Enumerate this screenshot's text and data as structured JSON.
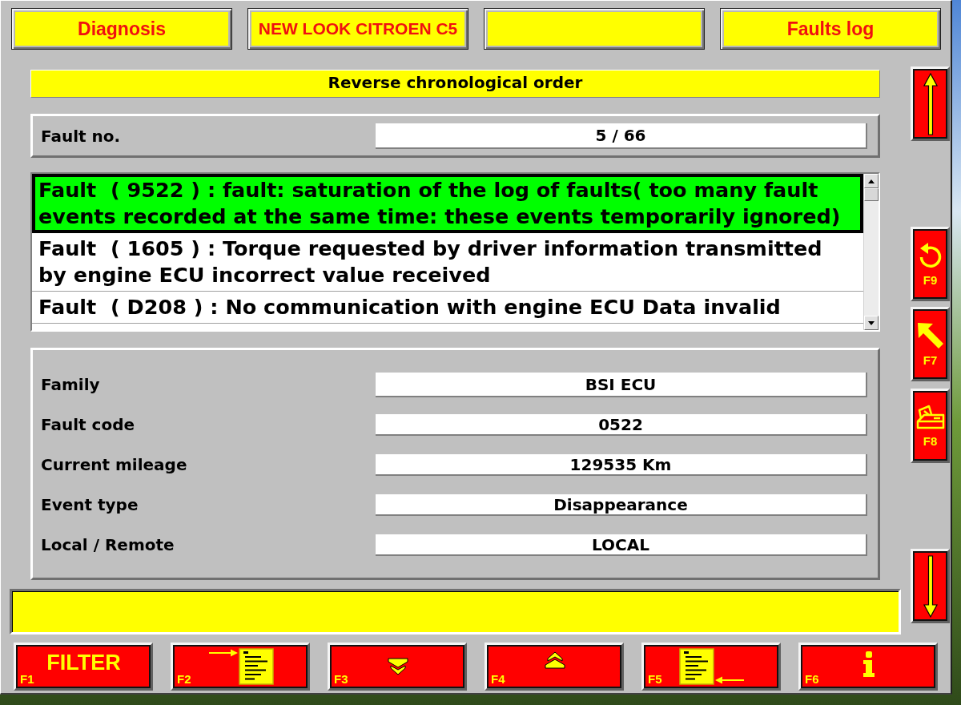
{
  "header": [
    {
      "kind": "title",
      "label": "Diagnosis"
    },
    {
      "kind": "vehicle",
      "label": "NEW LOOK CITROEN C5"
    },
    {
      "kind": "blank"
    },
    {
      "kind": "title",
      "label": "Faults log"
    }
  ],
  "sort_banner": "Reverse chronological order",
  "fault_no": {
    "label": "Fault no.",
    "value": "5 / 66"
  },
  "fault_list": [
    {
      "text": "Fault  ( 9522 ) : fault: saturation of the log of faults( too many fault events recorded at the same time: these events temporarily ignored)",
      "selected": true
    },
    {
      "text": "Fault  ( 1605 ) : Torque requested by driver information transmitted by engine ECU incorrect value received",
      "selected": false
    },
    {
      "text": "Fault  ( D208 ) : No communication with engine ECU Data invalid",
      "selected": false
    }
  ],
  "details": [
    {
      "label": "Family",
      "value": "BSI ECU"
    },
    {
      "label": "Fault code",
      "value": "0522"
    },
    {
      "label": "Current mileage",
      "value": "129535 Km"
    },
    {
      "label": "Event type",
      "value": "Disappearance"
    },
    {
      "label": "Local / Remote",
      "value": "LOCAL"
    }
  ],
  "side_buttons": [
    {
      "kind": "arrow-up"
    },
    {
      "kind": "undo",
      "key": "F9"
    },
    {
      "kind": "pointer",
      "key": "F7"
    },
    {
      "kind": "printer",
      "key": "F8"
    },
    {
      "kind": "arrow-down"
    }
  ],
  "function_keys": [
    {
      "key": "F1",
      "kind": "text",
      "label": "FILTER"
    },
    {
      "key": "F2",
      "kind": "export"
    },
    {
      "key": "F3",
      "kind": "page-down"
    },
    {
      "key": "F4",
      "kind": "page-up"
    },
    {
      "key": "F5",
      "kind": "import"
    },
    {
      "key": "F6",
      "kind": "info"
    }
  ]
}
